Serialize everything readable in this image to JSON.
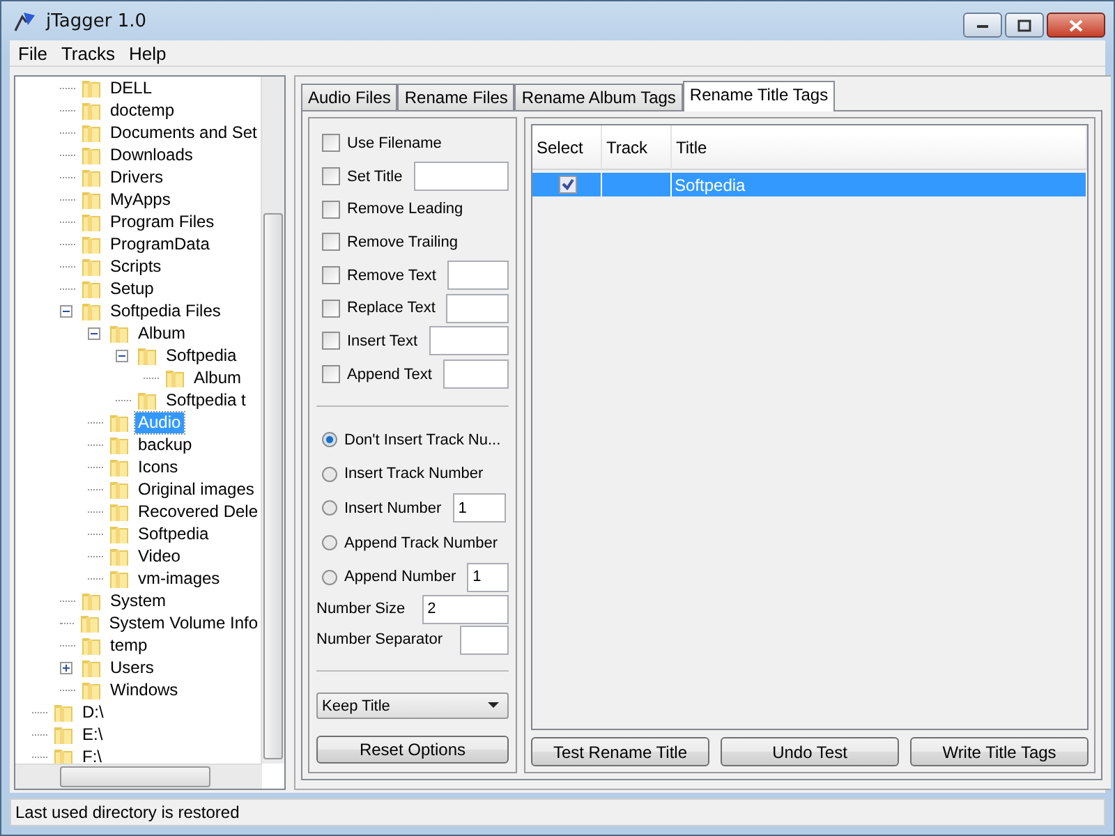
{
  "window": {
    "title": "jTagger 1.0"
  },
  "menu": [
    "File",
    "Tracks",
    "Help"
  ],
  "tree": {
    "items": [
      {
        "children": [
          {
            "label": "DELL",
            "selected": false
          },
          {
            "label": "doctemp",
            "selected": false
          },
          {
            "label": "Documents and Set",
            "selected": false
          },
          {
            "label": "Downloads",
            "selected": false
          },
          {
            "label": "Drivers",
            "selected": false
          },
          {
            "label": "MyApps",
            "selected": false
          },
          {
            "label": "Program Files",
            "selected": false
          },
          {
            "label": "ProgramData",
            "selected": false
          },
          {
            "label": "Scripts",
            "selected": false
          },
          {
            "label": "Setup",
            "selected": false
          },
          {
            "label": "Softpedia Files",
            "selected": false,
            "expanded": true,
            "children": [
              {
                "label": "Album",
                "selected": false,
                "expanded": true,
                "children": [
                  {
                    "label": "Softpedia",
                    "selected": false,
                    "expanded": true,
                    "children": [
                      {
                        "label": "Album",
                        "selected": false
                      }
                    ]
                  },
                  {
                    "label": "Softpedia t",
                    "selected": false
                  }
                ]
              },
              {
                "label": "Audio",
                "selected": true
              },
              {
                "label": "backup",
                "selected": false
              },
              {
                "label": "Icons",
                "selected": false
              },
              {
                "label": "Original images",
                "selected": false
              },
              {
                "label": "Recovered Dele",
                "selected": false
              },
              {
                "label": "Softpedia",
                "selected": false
              },
              {
                "label": "Video",
                "selected": false
              },
              {
                "label": "vm-images",
                "selected": false
              }
            ]
          },
          {
            "label": "System",
            "selected": false
          },
          {
            "label": "System Volume Info",
            "selected": false
          },
          {
            "label": "temp",
            "selected": false
          },
          {
            "label": "Users",
            "selected": false,
            "expanded": false
          },
          {
            "label": "Windows",
            "selected": false
          }
        ]
      },
      {
        "label": "D:\\",
        "selected": false
      },
      {
        "label": "E:\\",
        "selected": false
      },
      {
        "label": "F:\\",
        "selected": false
      }
    ]
  },
  "tabs": [
    {
      "label": "Audio Files",
      "selected": false
    },
    {
      "label": "Rename Files",
      "selected": false
    },
    {
      "label": "Rename Album Tags",
      "selected": false
    },
    {
      "label": "Rename Title Tags",
      "selected": true
    }
  ],
  "options": {
    "checks": [
      {
        "label": "Use Filename",
        "checked": false
      },
      {
        "label": "Set Title",
        "checked": false,
        "field": true
      },
      {
        "label": "Remove Leading",
        "checked": false
      },
      {
        "label": "Remove Trailing",
        "checked": false
      },
      {
        "label": "Remove Text",
        "checked": false,
        "field": true
      },
      {
        "label": "Replace Text",
        "checked": false,
        "field": true
      },
      {
        "label": "Insert Text",
        "checked": false,
        "field": true
      },
      {
        "label": "Append Text",
        "checked": false,
        "field": true
      }
    ],
    "radios": [
      {
        "label": "Don't Insert Track Nu...",
        "selected": true
      },
      {
        "label": "Insert Track Number",
        "selected": false
      },
      {
        "label": "Insert Number",
        "selected": false,
        "value": "1"
      },
      {
        "label": "Append Track Number",
        "selected": false
      },
      {
        "label": "Append Number",
        "selected": false,
        "value": "1"
      }
    ],
    "number_fields": [
      {
        "label": "Number Size",
        "value": "2"
      },
      {
        "label": "Number Separator"
      }
    ],
    "dropdown": {
      "value": "Keep Title"
    },
    "reset_button": "Reset Options"
  },
  "table": {
    "columns": [
      "Select",
      "Track",
      "Title"
    ],
    "rows": [
      {
        "checked": true,
        "title": "Softpedia",
        "selected": true
      }
    ]
  },
  "buttons": [
    "Test Rename Title",
    "Undo Test",
    "Write Title Tags"
  ],
  "status_bar": "Last used directory is restored"
}
